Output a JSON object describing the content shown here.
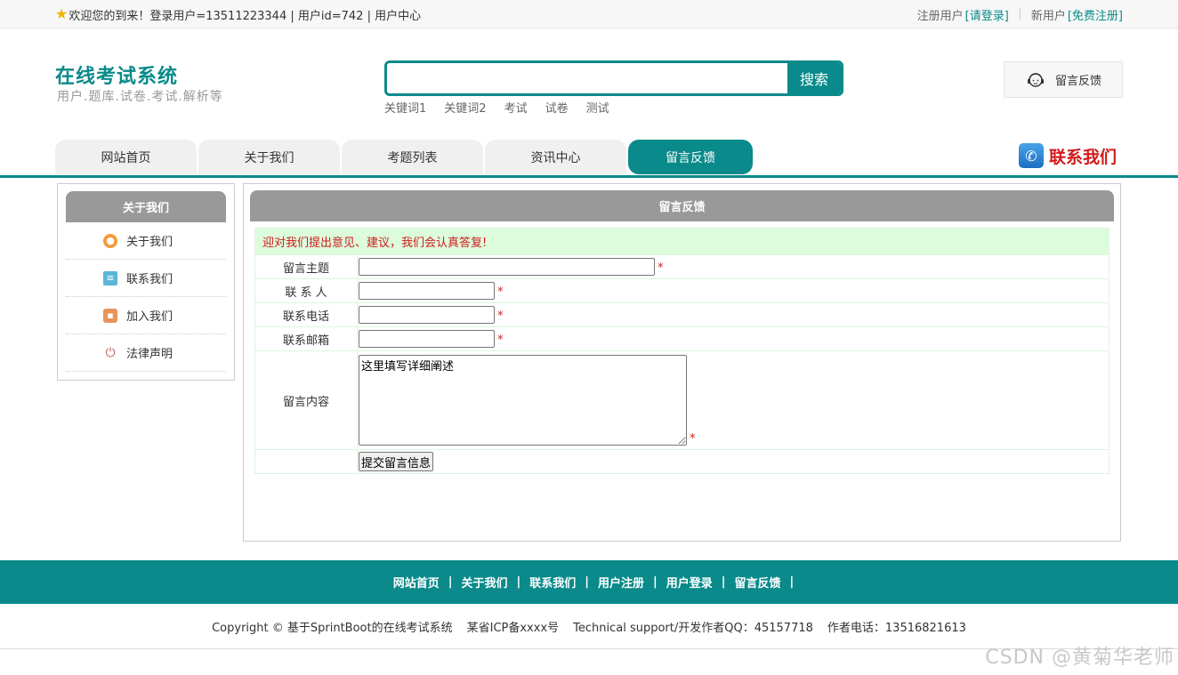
{
  "topbar": {
    "welcome": "欢迎您的到来！登录用户=13511223344 | 用户id=742 | 用户中心",
    "register_user_text": "注册用户",
    "login_link": "[请登录]",
    "new_user_text": "新用户",
    "register_link": "[免费注册]"
  },
  "header": {
    "site_title": "在线考试系统",
    "site_subtitle": "用户.题库.试卷.考试.解析等",
    "search_placeholder": "",
    "search_button": "搜索",
    "keywords": [
      "关键词1",
      "关键词2",
      "考试",
      "试卷",
      "测试"
    ],
    "feedback_button": "留言反馈"
  },
  "nav": {
    "items": [
      "网站首页",
      "关于我们",
      "考题列表",
      "资讯中心",
      "留言反馈"
    ],
    "active": "留言反馈",
    "contact_us": "联系我们"
  },
  "sidebar": {
    "title": "关于我们",
    "items": [
      {
        "label": "关于我们",
        "icon": "info-circle-icon"
      },
      {
        "label": "联系我们",
        "icon": "clipboard-icon"
      },
      {
        "label": "加入我们",
        "icon": "lock-icon"
      },
      {
        "label": "法律声明",
        "icon": "power-icon"
      }
    ]
  },
  "form": {
    "title": "留言反馈",
    "notice": "迎对我们提出意见、建议，我们会认真答复!",
    "fields": {
      "subject_label": "留言主题",
      "contact_label": "联 系 人",
      "phone_label": "联系电话",
      "email_label": "联系邮箱",
      "content_label": "留言内容"
    },
    "values": {
      "subject": "",
      "contact": "",
      "phone": "",
      "email": "",
      "content": "这里填写详细阐述"
    },
    "required_mark": "*",
    "submit_label": "提交留言信息"
  },
  "footer": {
    "links": [
      "网站首页",
      "关于我们",
      "联系我们",
      "用户注册",
      "用户登录",
      "留言反馈"
    ],
    "separator": "|",
    "copyright": "Copyright © 基于SprintBoot的在线考试系统",
    "icp": "某省ICP备xxxx号",
    "support": "Technical support/开发作者QQ：45157718",
    "phone": "作者电话：13516821613"
  },
  "watermark": "CSDN @黄菊华老师",
  "colors": {
    "accent": "#0a8a8a",
    "required": "#d11a1a",
    "panel_header": "#999999",
    "notice_bg": "#dcfcdc"
  }
}
